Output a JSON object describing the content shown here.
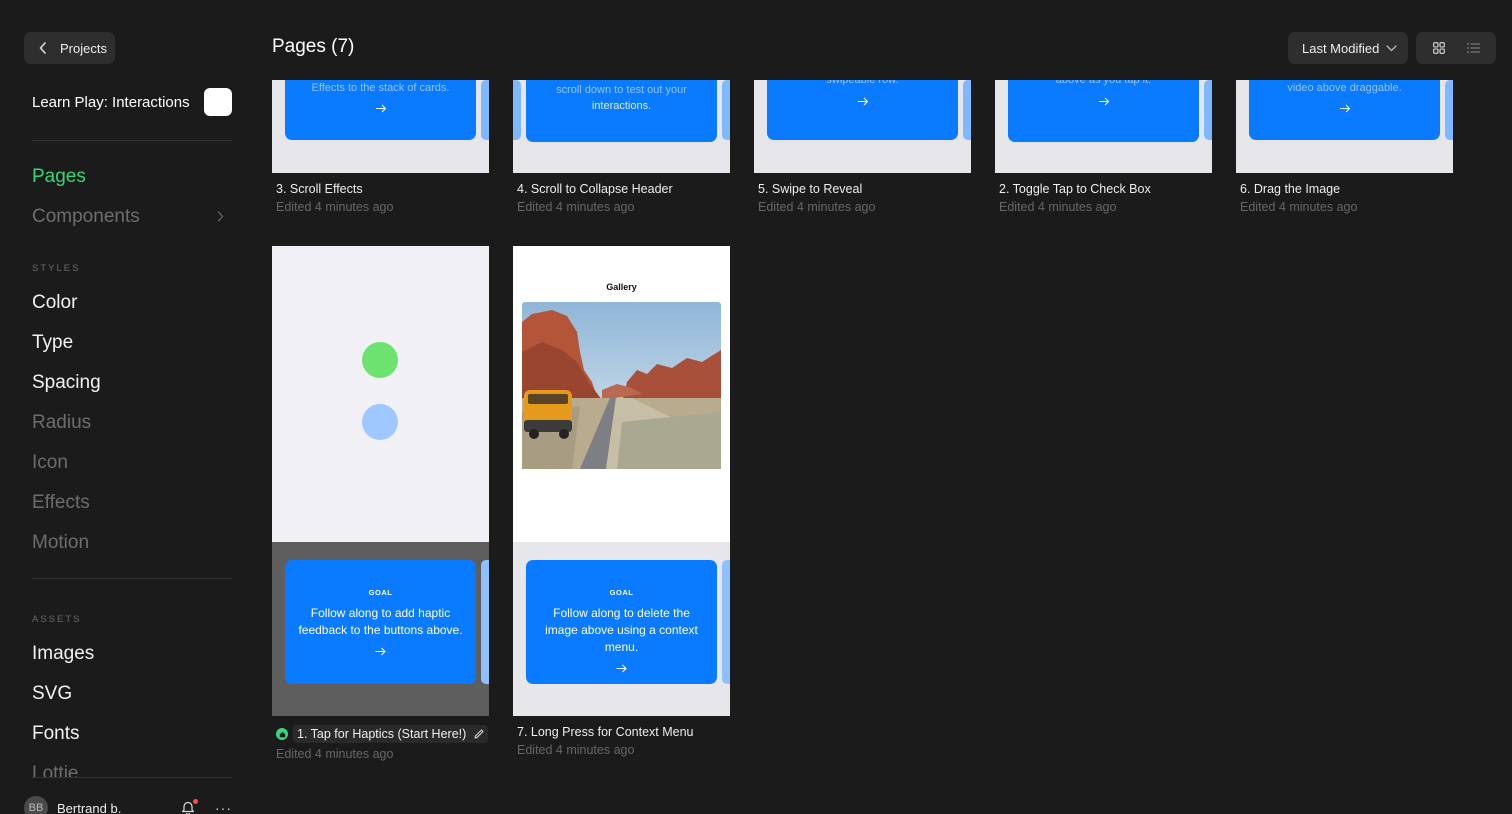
{
  "sidebar": {
    "back_label": "Projects",
    "project_name": "Learn Play: Interactions",
    "nav": {
      "pages": "Pages",
      "components": "Components"
    },
    "styles_label": "STYLES",
    "styles": [
      "Color",
      "Type",
      "Spacing",
      "Radius",
      "Icon",
      "Effects",
      "Motion"
    ],
    "assets_label": "ASSETS",
    "assets": [
      "Images",
      "SVG",
      "Fonts",
      "Lottie"
    ],
    "user": {
      "initials": "BB",
      "name": "Bertrand b."
    }
  },
  "header": {
    "title": "Pages (7)",
    "sort_label": "Last Modified"
  },
  "colors": {
    "accent_green": "#36d67c",
    "goal_blue": "#0a7aff"
  },
  "pages": [
    {
      "title": "3. Scroll Effects",
      "edited": "Edited 4 minutes ago",
      "thumb_text": "Effects to the stack of cards."
    },
    {
      "title": "4. Scroll to Collapse Header",
      "edited": "Edited 4 minutes ago",
      "thumb_text_1": "scroll down to test out your",
      "thumb_text_2": "interactions."
    },
    {
      "title": "5. Swipe to Reveal",
      "edited": "Edited 4 minutes ago",
      "thumb_text": "swipeable row."
    },
    {
      "title": "2. Toggle Tap to Check Box",
      "edited": "Edited 4 minutes ago",
      "thumb_text": "above as you tap it."
    },
    {
      "title": "6. Drag the Image",
      "edited": "Edited 4 minutes ago",
      "thumb_text": "video above draggable."
    },
    {
      "title": "1. Tap for Haptics (Start Here!)",
      "edited": "Edited 4 minutes ago",
      "goal_label": "GOAL",
      "goal_text": "Follow along to add haptic feedback to the buttons above."
    },
    {
      "title": "7. Long Press for Context Menu",
      "edited": "Edited 4 minutes ago",
      "gallery_title": "Gallery",
      "goal_label": "GOAL",
      "goal_text": "Follow along to delete the image above using a context menu."
    }
  ]
}
